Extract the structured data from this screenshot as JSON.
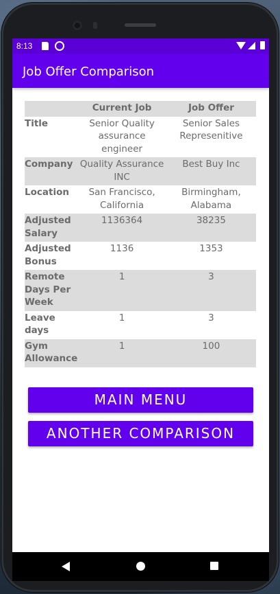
{
  "status_bar": {
    "time": "8:13"
  },
  "app_bar": {
    "title": "Job Offer Comparison"
  },
  "comparison": {
    "headers": [
      "",
      "Current Job",
      "Job Offer"
    ],
    "rows": [
      {
        "label": "Title",
        "current": "Senior Quality assurance engineer",
        "offer": "Senior Sales Represenitive"
      },
      {
        "label": "Company",
        "current": "Quality Assurance INC",
        "offer": "Best Buy Inc"
      },
      {
        "label": "Location",
        "current": "San Francisco, California",
        "offer": "Birmingham, Alabama"
      },
      {
        "label": "Adjusted Salary",
        "current": "1136364",
        "offer": "38235"
      },
      {
        "label": "Adjusted Bonus",
        "current": "1136",
        "offer": "1353"
      },
      {
        "label": "Remote Days Per Week",
        "current": "1",
        "offer": "3"
      },
      {
        "label": "Leave days",
        "current": "1",
        "offer": "3"
      },
      {
        "label": "Gym Allowance",
        "current": "1",
        "offer": "100"
      }
    ]
  },
  "buttons": {
    "main_menu": "MAIN MENU",
    "another_comparison": "ANOTHER COMPARISON"
  },
  "colors": {
    "primary": "#6200ee",
    "status_bar": "#5a00d6",
    "row_shade": "#dcdcdc",
    "text": "#6b6b6b"
  },
  "icons": {
    "status": [
      "sd-card-icon",
      "sync-icon",
      "wifi-icon",
      "signal-icon",
      "battery-icon"
    ],
    "navigation": [
      "back-icon",
      "home-icon",
      "recents-icon"
    ]
  }
}
